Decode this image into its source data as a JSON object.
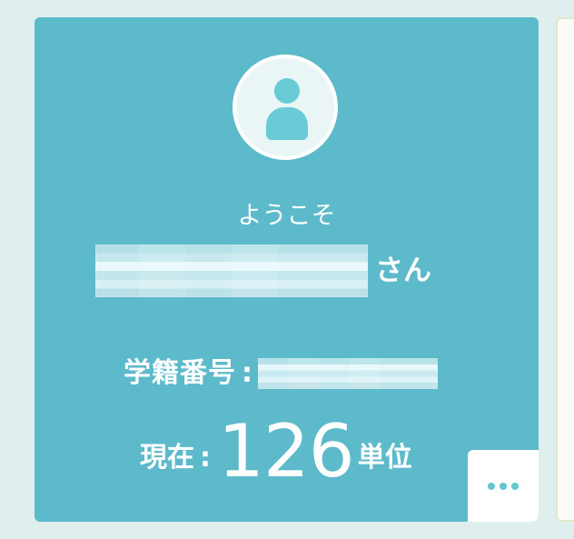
{
  "profile": {
    "welcome_text": "ようこそ",
    "name_suffix": "さん",
    "student_id_label": "学籍番号",
    "separator": ":",
    "current_label": "現在",
    "credits_value": "126",
    "credits_unit": "単位",
    "more_icon": "more-horizontal-icon",
    "avatar_icon": "user-icon"
  },
  "colors": {
    "card_background": "#5cbacb",
    "avatar_fill": "#68cbd5",
    "page_background": "#e1eeee"
  }
}
